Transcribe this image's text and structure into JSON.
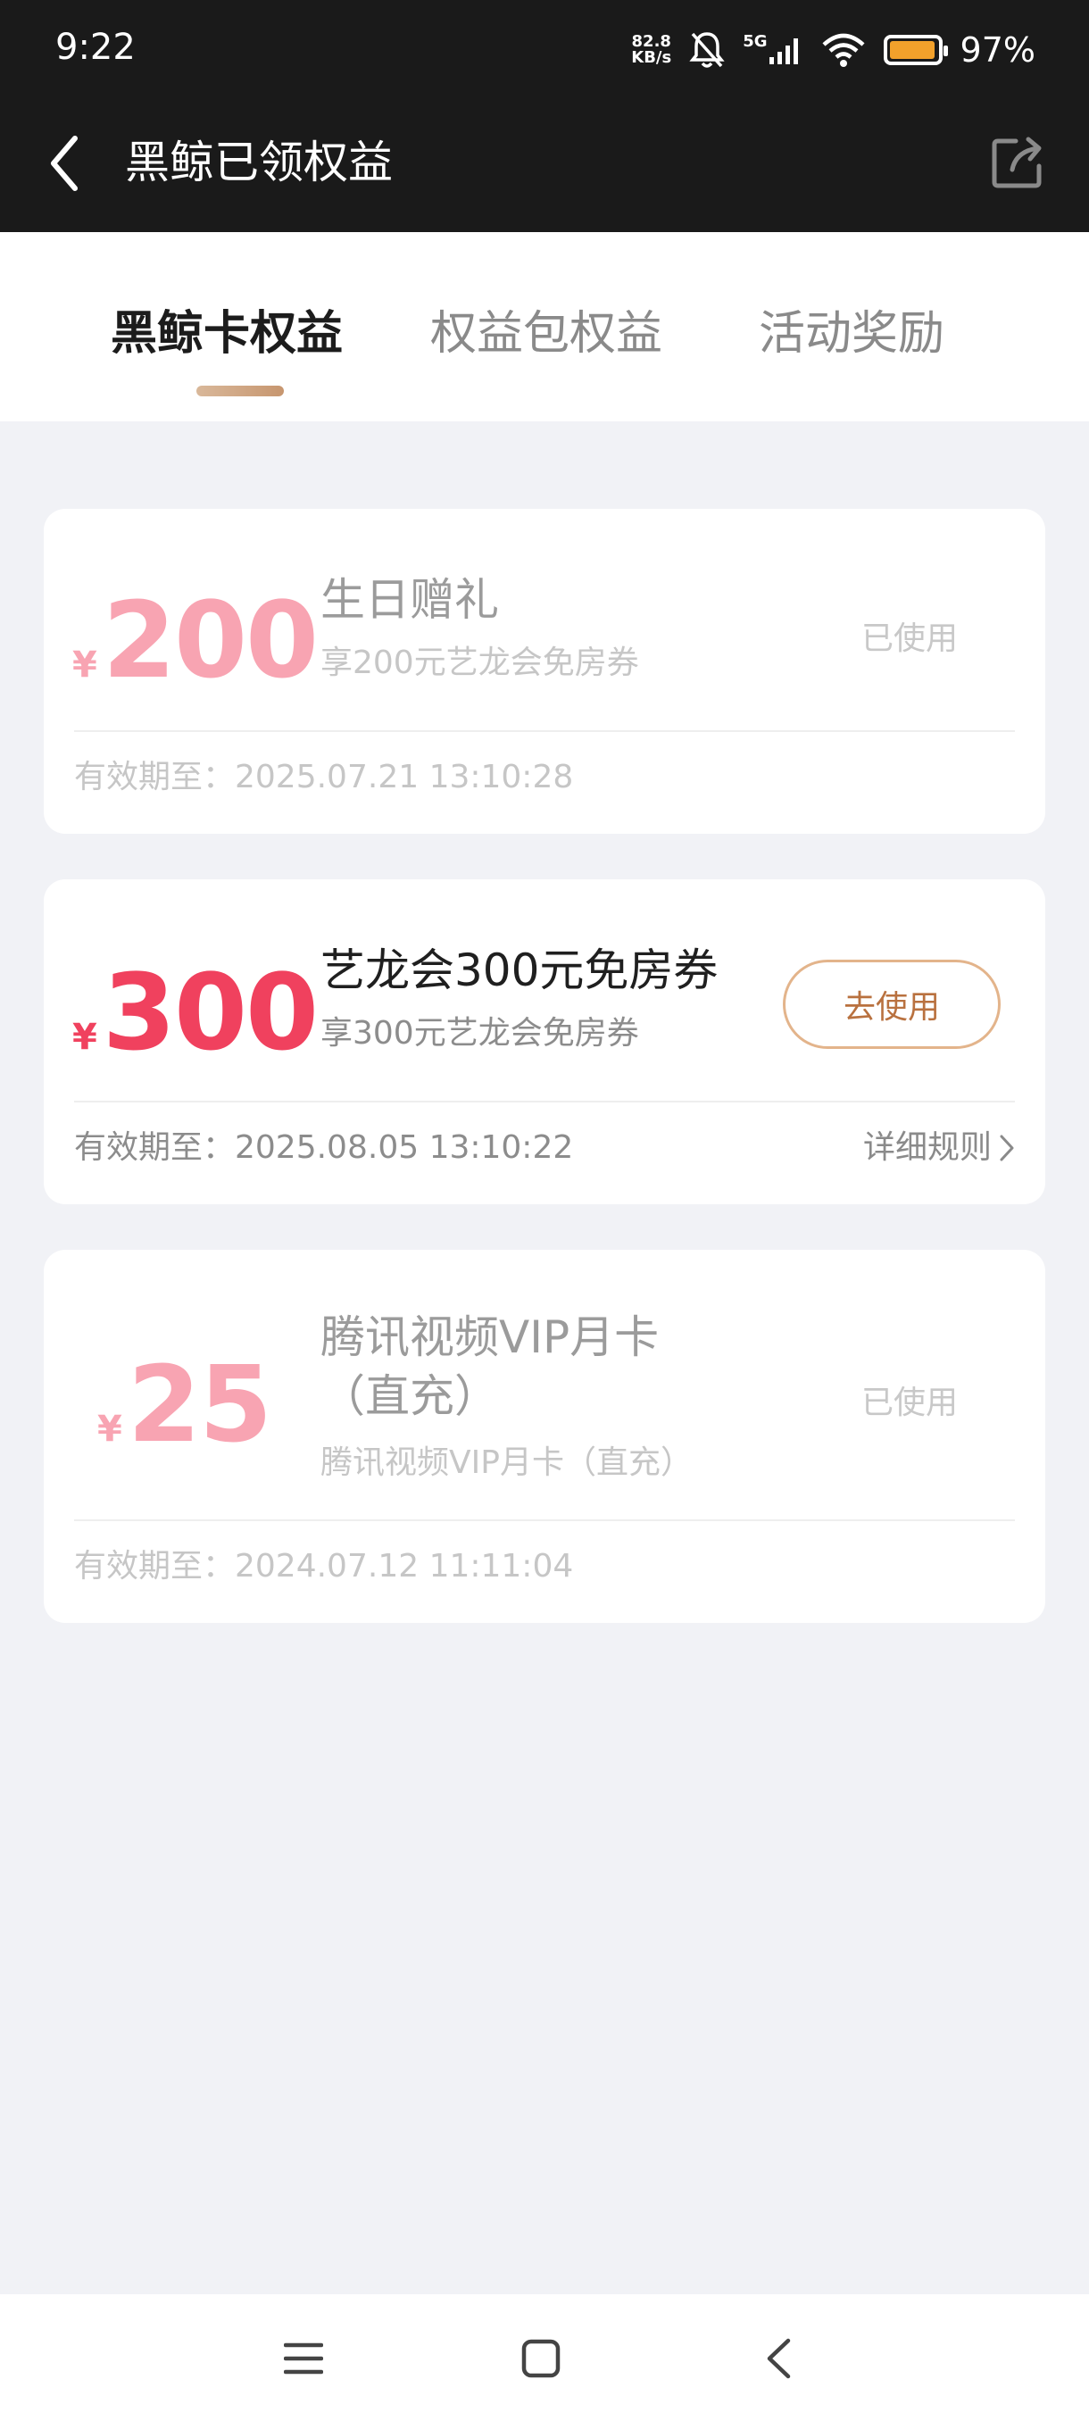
{
  "status_bar": {
    "time": "9:22",
    "net_speed_value": "82.8",
    "net_speed_unit": "KB/s",
    "network": "5G",
    "battery_percent": "97%",
    "battery_level": 0.97,
    "battery_color": "#f2a12b"
  },
  "header": {
    "title": "黑鲸已领权益",
    "back_icon": "chevron-left-icon",
    "share_icon": "share-icon"
  },
  "tabs": [
    {
      "label": "黑鲸卡权益",
      "active": true
    },
    {
      "label": "权益包权益",
      "active": false
    },
    {
      "label": "活动奖励",
      "active": false
    }
  ],
  "cards": [
    {
      "currency": "¥",
      "amount": "200",
      "title": "生日赠礼",
      "subtitle": "享200元艺龙会免房券",
      "status": "已使用",
      "expiry": "有效期至：2025.07.21 13:10:28"
    },
    {
      "currency": "¥",
      "amount": "300",
      "title": "艺龙会300元免房券",
      "subtitle": "享300元艺龙会免房券",
      "action": "去使用",
      "expiry": "有效期至：2025.08.05 13:10:22",
      "rules_link": "详细规则"
    },
    {
      "currency": "¥",
      "amount": "25",
      "title_line1": "腾讯视频VIP月卡",
      "title_line2": "（直充）",
      "subtitle": "腾讯视频VIP月卡（直充）",
      "status": "已使用",
      "expiry": "有效期至：2024.07.12 11:11:04"
    }
  ],
  "colors": {
    "accent_red": "#f0415e",
    "faded_red": "#f8a4b2",
    "gold_border": "#e3b48b",
    "gold_text": "#b9713f",
    "background": "#f1f2f6"
  },
  "bottom_nav": {
    "menu_icon": "menu-icon",
    "home_icon": "home-square-icon",
    "back_icon": "back-triangle-icon"
  }
}
